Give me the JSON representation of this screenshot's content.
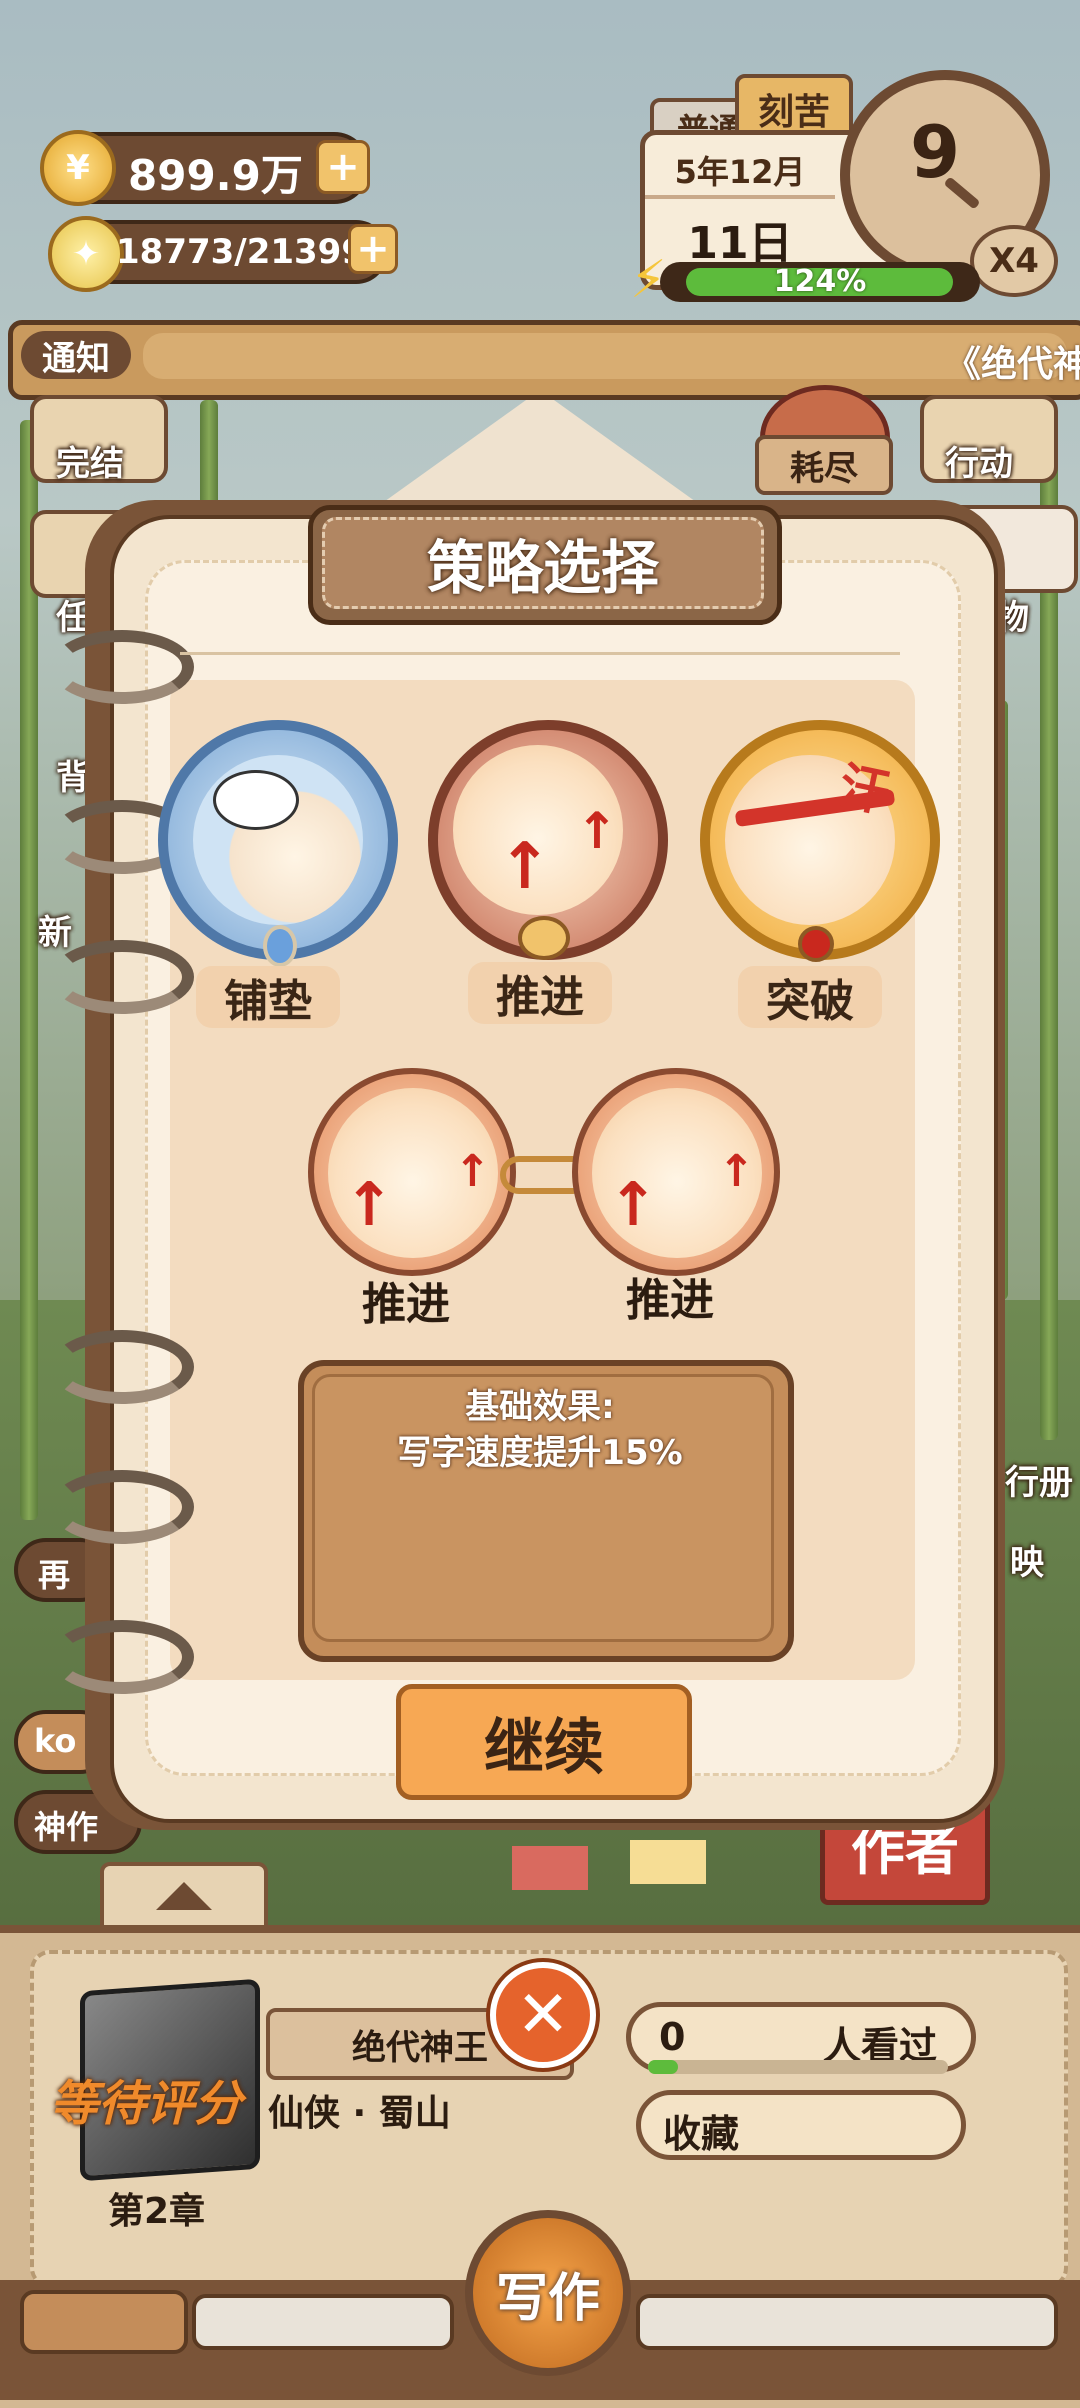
{
  "hud": {
    "coins": "899.9万",
    "inspiration": "18773/21399",
    "mode_normal": "普通",
    "mode_hard": "刻苦",
    "date_year_month": "5年12月",
    "date_day": "11日",
    "clock_hour": "9",
    "speed": "X4",
    "energy_percent": "124%",
    "energy_fill": 0.92
  },
  "notice": {
    "label": "通知",
    "ticker": "《绝代神"
  },
  "side_left": [
    "完结",
    "任",
    "背",
    "新"
  ],
  "side_right": [
    "行动",
    "物",
    "行册",
    "映"
  ],
  "center_badge": "耗尽",
  "left_partial_labels": [
    "再",
    "ko",
    "神作"
  ],
  "dialog": {
    "title": "策略选择",
    "options": [
      {
        "label": "铺垫",
        "color": "#cfe3f4"
      },
      {
        "label": "推进",
        "color": "#f4c9a8"
      },
      {
        "label": "突破",
        "color": "#f6c46b"
      }
    ],
    "chain": [
      "推进",
      "推进"
    ],
    "effect_title": "基础效果:",
    "effect_text": "写字速度提升15%",
    "continue_label": "继续"
  },
  "book": {
    "status": "等待评分",
    "name": "绝代神王",
    "genre": "仙侠 · 蜀山",
    "chapter": "第2章",
    "views_count": "0",
    "views_label": "人看过",
    "collect_label": "收藏",
    "write_label": "写作"
  },
  "background_signs": {
    "author": "作者"
  }
}
